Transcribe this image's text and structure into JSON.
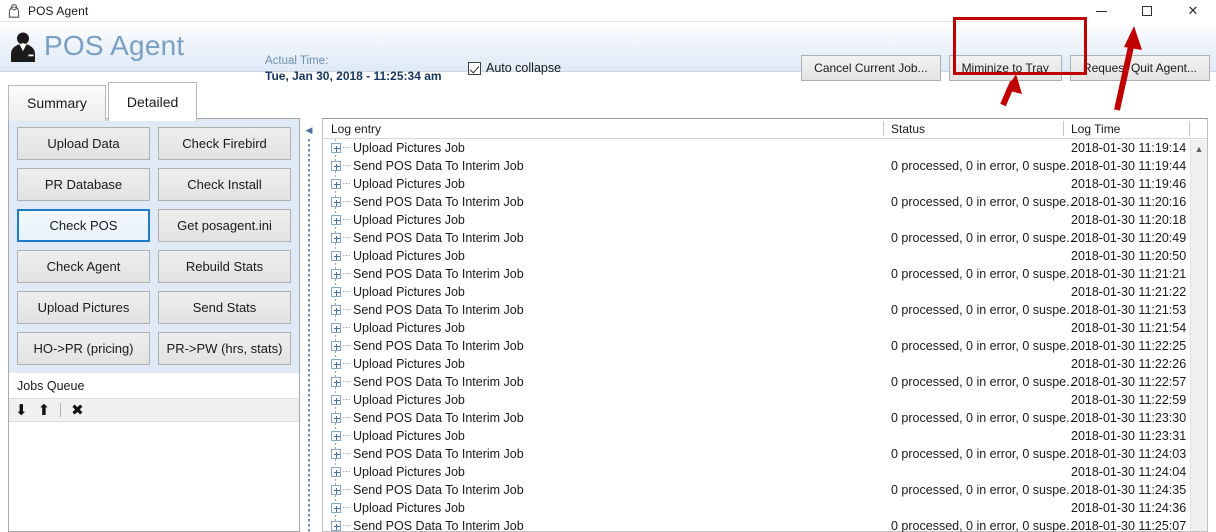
{
  "window": {
    "title": "POS Agent",
    "icon": "agent-icon",
    "controls": {
      "minimize": "minimize",
      "maximize": "maximize",
      "close": "close"
    }
  },
  "header": {
    "app_title": "POS Agent",
    "actual_time_label": "Actual Time:",
    "actual_time_value": "Tue, Jan 30, 2018 - 11:25:34 am",
    "auto_collapse_label": "Auto collapse",
    "auto_collapse_checked": true,
    "buttons": [
      {
        "label": "Cancel Current Job..."
      },
      {
        "label": "Miminize to Tray"
      },
      {
        "label": "Request Quit Agent..."
      }
    ]
  },
  "tabs": [
    {
      "label": "Summary",
      "active": false
    },
    {
      "label": "Detailed",
      "active": true
    }
  ],
  "left_panel": {
    "action_buttons": [
      {
        "label": "Upload Data",
        "focused": false
      },
      {
        "label": "Check Firebird",
        "focused": false
      },
      {
        "label": "PR Database",
        "focused": false
      },
      {
        "label": "Check Install",
        "focused": false
      },
      {
        "label": "Check POS",
        "focused": true
      },
      {
        "label": "Get posagent.ini",
        "focused": false
      },
      {
        "label": "Check Agent",
        "focused": false
      },
      {
        "label": "Rebuild Stats",
        "focused": false
      },
      {
        "label": "Upload Pictures",
        "focused": false
      },
      {
        "label": "Send Stats",
        "focused": false
      },
      {
        "label": "HO->PR (pricing)",
        "focused": false
      },
      {
        "label": "PR->PW (hrs, stats)",
        "focused": false
      }
    ],
    "jobs_queue": {
      "title": "Jobs Queue",
      "toolbar": [
        {
          "icon": "move-down-icon",
          "glyph": "⬇"
        },
        {
          "icon": "move-up-icon",
          "glyph": "⬆"
        },
        {
          "icon": "delete-icon",
          "glyph": "✖"
        }
      ],
      "items": []
    }
  },
  "log_grid": {
    "columns": [
      {
        "label": "Log entry"
      },
      {
        "label": "Status"
      },
      {
        "label": "Log Time"
      }
    ],
    "rows": [
      {
        "entry": "Upload Pictures Job",
        "status": "",
        "time": "2018-01-30 11:19:14"
      },
      {
        "entry": "Send POS Data To Interim Job",
        "status": "0 processed, 0 in error, 0 suspe...",
        "time": "2018-01-30 11:19:44"
      },
      {
        "entry": "Upload Pictures Job",
        "status": "",
        "time": "2018-01-30 11:19:46"
      },
      {
        "entry": "Send POS Data To Interim Job",
        "status": "0 processed, 0 in error, 0 suspe...",
        "time": "2018-01-30 11:20:16"
      },
      {
        "entry": "Upload Pictures Job",
        "status": "",
        "time": "2018-01-30 11:20:18"
      },
      {
        "entry": "Send POS Data To Interim Job",
        "status": "0 processed, 0 in error, 0 suspe...",
        "time": "2018-01-30 11:20:49"
      },
      {
        "entry": "Upload Pictures Job",
        "status": "",
        "time": "2018-01-30 11:20:50"
      },
      {
        "entry": "Send POS Data To Interim Job",
        "status": "0 processed, 0 in error, 0 suspe...",
        "time": "2018-01-30 11:21:21"
      },
      {
        "entry": "Upload Pictures Job",
        "status": "",
        "time": "2018-01-30 11:21:22"
      },
      {
        "entry": "Send POS Data To Interim Job",
        "status": "0 processed, 0 in error, 0 suspe...",
        "time": "2018-01-30 11:21:53"
      },
      {
        "entry": "Upload Pictures Job",
        "status": "",
        "time": "2018-01-30 11:21:54"
      },
      {
        "entry": "Send POS Data To Interim Job",
        "status": "0 processed, 0 in error, 0 suspe...",
        "time": "2018-01-30 11:22:25"
      },
      {
        "entry": "Upload Pictures Job",
        "status": "",
        "time": "2018-01-30 11:22:26"
      },
      {
        "entry": "Send POS Data To Interim Job",
        "status": "0 processed, 0 in error, 0 suspe...",
        "time": "2018-01-30 11:22:57"
      },
      {
        "entry": "Upload Pictures Job",
        "status": "",
        "time": "2018-01-30 11:22:59"
      },
      {
        "entry": "Send POS Data To Interim Job",
        "status": "0 processed, 0 in error, 0 suspe...",
        "time": "2018-01-30 11:23:30"
      },
      {
        "entry": "Upload Pictures Job",
        "status": "",
        "time": "2018-01-30 11:23:31"
      },
      {
        "entry": "Send POS Data To Interim Job",
        "status": "0 processed, 0 in error, 0 suspe...",
        "time": "2018-01-30 11:24:03"
      },
      {
        "entry": "Upload Pictures Job",
        "status": "",
        "time": "2018-01-30 11:24:04"
      },
      {
        "entry": "Send POS Data To Interim Job",
        "status": "0 processed, 0 in error, 0 suspe...",
        "time": "2018-01-30 11:24:35"
      },
      {
        "entry": "Upload Pictures Job",
        "status": "",
        "time": "2018-01-30 11:24:36"
      },
      {
        "entry": "Send POS Data To Interim Job",
        "status": "0 processed, 0 in error, 0 suspe...",
        "time": "2018-01-30 11:25:07"
      }
    ]
  },
  "annotations": {
    "highlight_color": "#c00000",
    "highlight_target": "Miminize to Tray",
    "arrows": [
      {
        "points_to": "miminize-to-tray-button"
      },
      {
        "points_to": "window-minimize-button"
      }
    ]
  }
}
